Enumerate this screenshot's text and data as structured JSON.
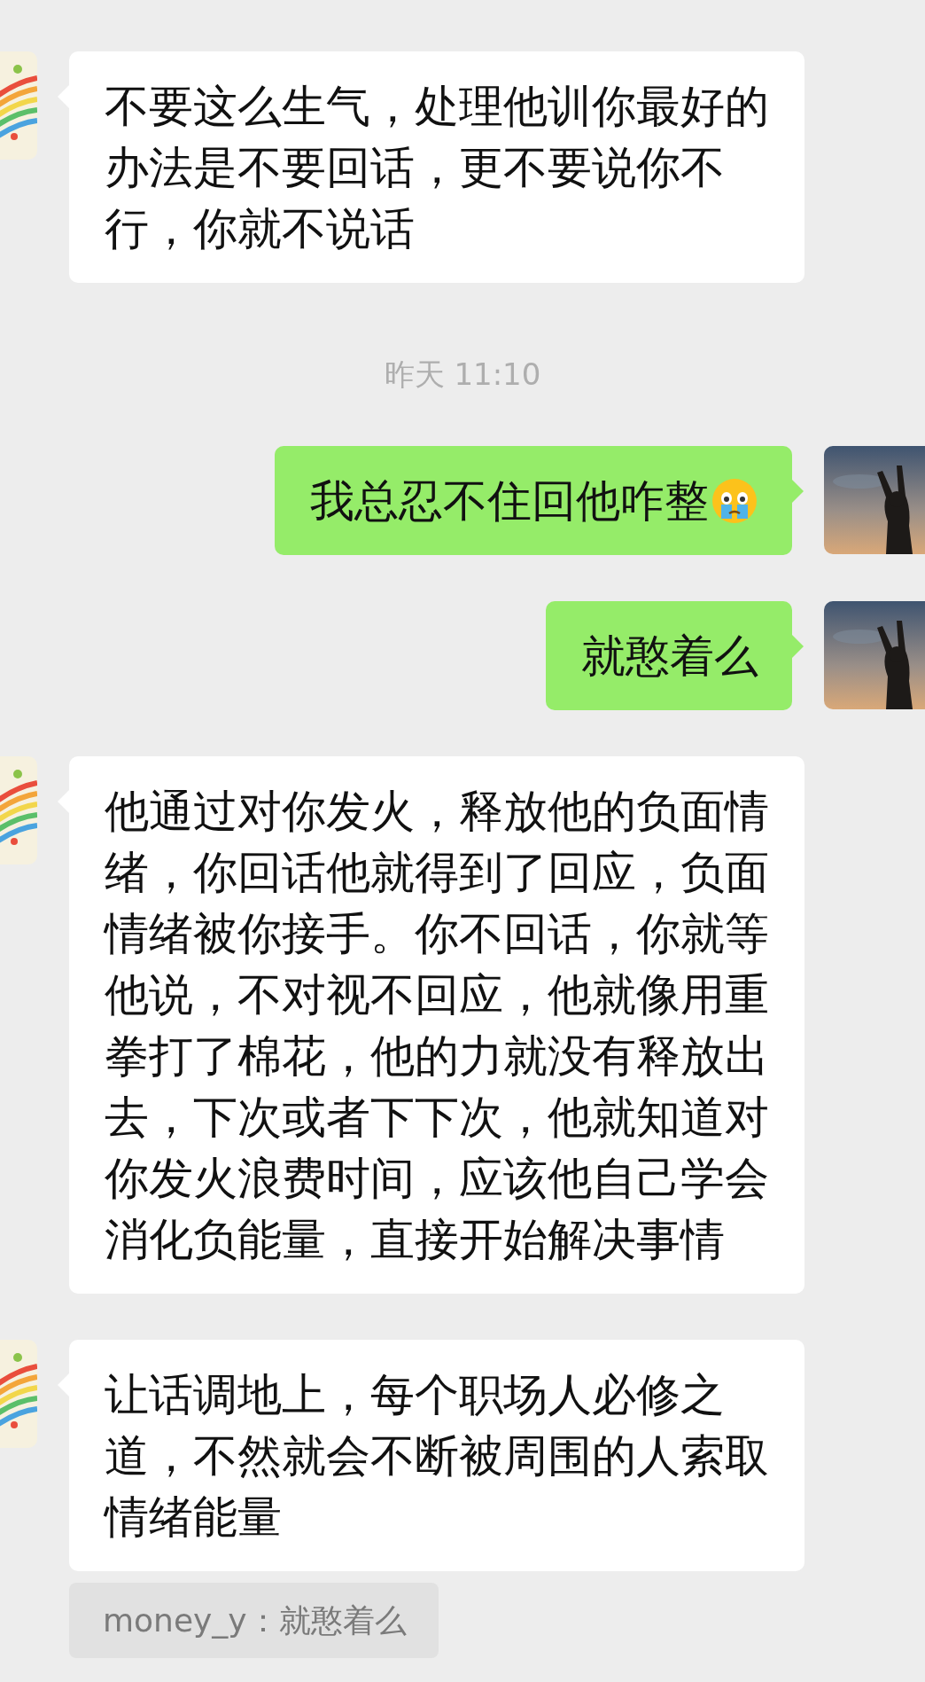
{
  "messages": [
    {
      "kind": "received",
      "text": "不要这么生气，处理他训你最好的办法是不要回话，更不要说你不行，你就不说话"
    },
    {
      "kind": "time",
      "text": "昨天 11:10"
    },
    {
      "kind": "sent",
      "text": "我总忍不住回他咋整",
      "has_emoji": true
    },
    {
      "kind": "sent",
      "text": "就憨着么"
    },
    {
      "kind": "received",
      "text": "他通过对你发火，释放他的负面情绪，你回话他就得到了回应，负面情绪被你接手。你不回话，你就等他说，不对视不回应，他就像用重拳打了棉花，他的力就没有释放出去，下次或者下下次，他就知道对你发火浪费时间，应该他自己学会消化负能量，直接开始解决事情"
    },
    {
      "kind": "received",
      "text": "让话调地上，每个职场人必修之道，不然就会不断被周围的人索取情绪能量"
    }
  ],
  "quote": {
    "text": "money_y：就憨着么"
  }
}
